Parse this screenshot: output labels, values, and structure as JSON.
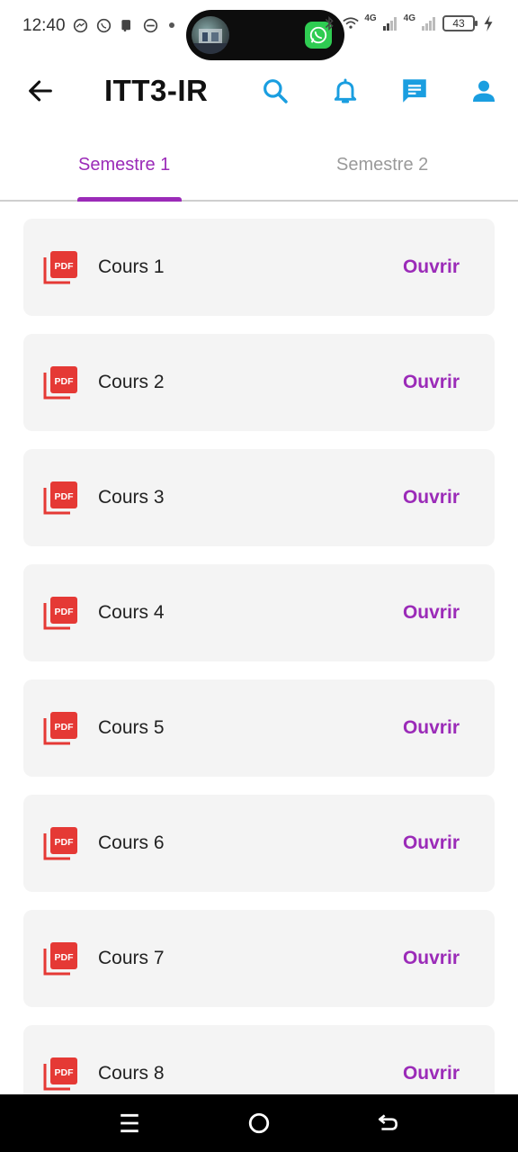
{
  "status_bar": {
    "time": "12:40",
    "left_icons": [
      "messenger-icon",
      "whatsapp-icon",
      "notification-icon",
      "app-icon"
    ],
    "network_1": "4G",
    "network_2": "4G",
    "battery": "43"
  },
  "header": {
    "title": "ITT3-IR",
    "accent_color": "#1a9ee0"
  },
  "tabs": [
    {
      "label": "Semestre 1",
      "active": true
    },
    {
      "label": "Semestre 2",
      "active": false
    }
  ],
  "courses": [
    {
      "title": "Cours 1",
      "action": "Ouvrir"
    },
    {
      "title": "Cours 2",
      "action": "Ouvrir"
    },
    {
      "title": "Cours 3",
      "action": "Ouvrir"
    },
    {
      "title": "Cours 4",
      "action": "Ouvrir"
    },
    {
      "title": "Cours 5",
      "action": "Ouvrir"
    },
    {
      "title": "Cours 6",
      "action": "Ouvrir"
    },
    {
      "title": "Cours 7",
      "action": "Ouvrir"
    },
    {
      "title": "Cours 8",
      "action": "Ouvrir"
    }
  ],
  "colors": {
    "primary": "#9b2bb8",
    "pdf_red": "#e53935",
    "icon_blue": "#1a9ee0"
  }
}
